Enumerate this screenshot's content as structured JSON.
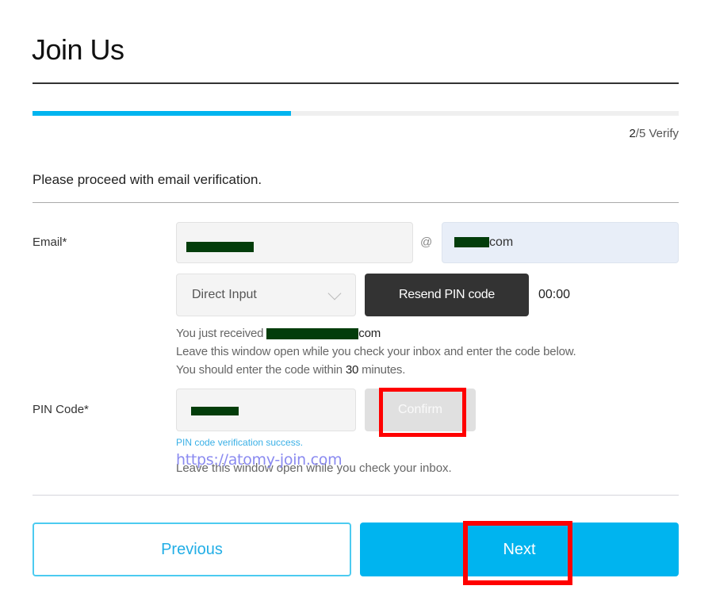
{
  "page": {
    "title": "Join Us",
    "progress": {
      "current_step": 2,
      "total_steps": 5,
      "fraction": 0.4,
      "step_current_label": "2",
      "step_rest_label": "/5 Verify"
    },
    "intro": "Please proceed with email verification."
  },
  "email": {
    "label": "Email*",
    "local_value": "[redacted]",
    "at_sign": "@",
    "domain_suffix": "com",
    "domain_select": "Direct Input",
    "resend_label": "Resend PIN code",
    "timer": "00:00",
    "msg_received_prefix": "You just received",
    "msg_received_suffix": "com",
    "msg_leave_open": "Leave this window open while you check your inbox and enter the code below.",
    "msg_within_prefix": "You should enter the code within ",
    "msg_within_value": "30",
    "msg_within_suffix": " minutes."
  },
  "pin": {
    "label": "PIN Code*",
    "value": "[redacted]",
    "confirm_label": "Confirm",
    "success_msg": "PIN code verification success.",
    "msg_leave_open": "Leave this window open while you check your inbox."
  },
  "watermark": "https://atomy-join.com",
  "buttons": {
    "previous": "Previous",
    "next": "Next"
  },
  "colors": {
    "accent": "#00b4ef",
    "highlight": "#ff0000",
    "dark_button": "#333333",
    "success_text": "#3ab0e6"
  }
}
